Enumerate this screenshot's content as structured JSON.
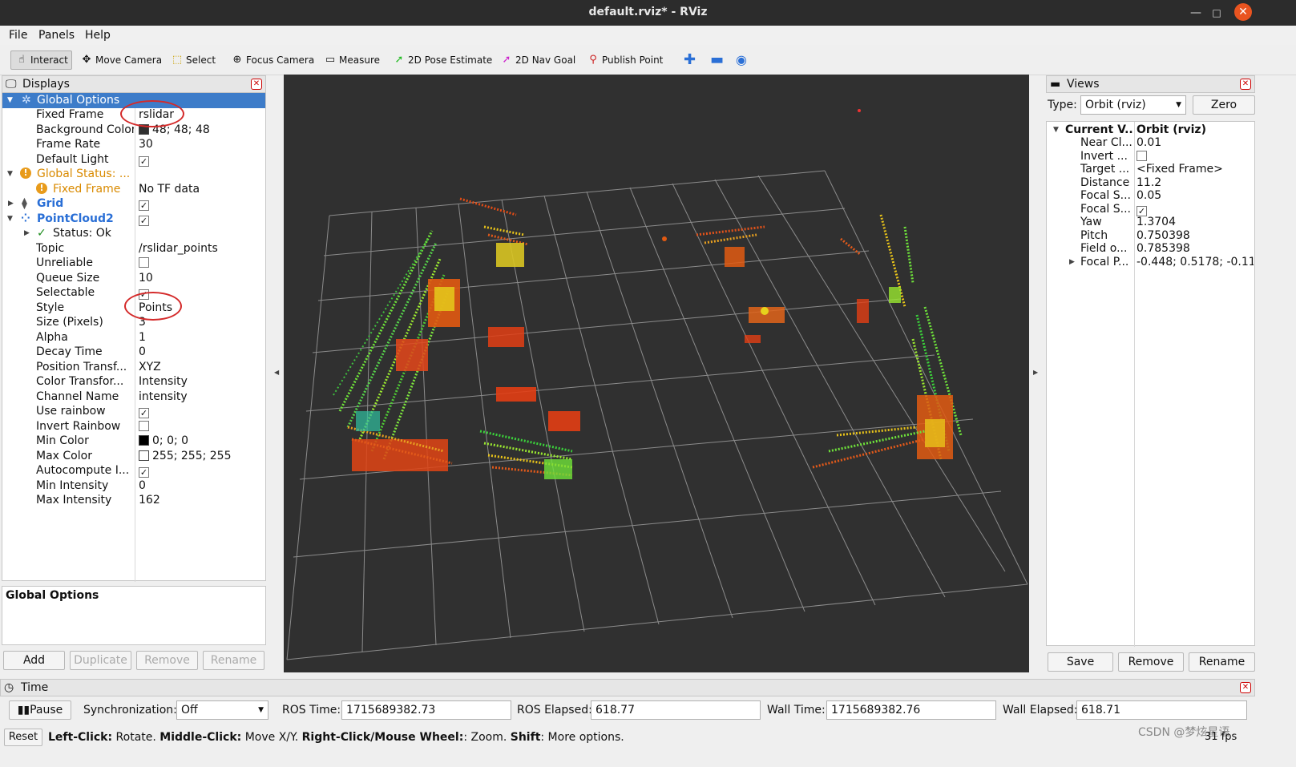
{
  "window": {
    "title": "default.rviz* - RViz"
  },
  "menu": [
    "File",
    "Panels",
    "Help"
  ],
  "toolbar": {
    "tools": [
      {
        "label": "Interact",
        "icon": "hand-icon",
        "color": "#333333"
      },
      {
        "label": "Move Camera",
        "icon": "move-camera-icon",
        "color": "#555555"
      },
      {
        "label": "Select",
        "icon": "select-icon",
        "color": "#c9a000"
      },
      {
        "label": "Focus Camera",
        "icon": "focus-camera-icon",
        "color": "#555555"
      },
      {
        "label": "Measure",
        "icon": "ruler-icon",
        "color": "#555555"
      },
      {
        "label": "2D Pose Estimate",
        "icon": "pose-arrow-icon",
        "color": "#22bb22"
      },
      {
        "label": "2D Nav Goal",
        "icon": "nav-goal-arrow-icon",
        "color": "#cc22cc"
      },
      {
        "label": "Publish Point",
        "icon": "map-pin-icon",
        "color": "#cc2222"
      }
    ]
  },
  "displays": {
    "title": "Displays",
    "rows": [
      {
        "key": "Global Options",
        "value": ""
      },
      {
        "key": "Fixed Frame",
        "value": "rslidar"
      },
      {
        "key": "Background Color",
        "value": "48; 48; 48"
      },
      {
        "key": "Frame Rate",
        "value": "30"
      },
      {
        "key": "Default Light",
        "value": ""
      },
      {
        "key": "Global Status: ...",
        "value": ""
      },
      {
        "key": "Fixed Frame",
        "value": "No TF data"
      },
      {
        "key": "Grid",
        "value": ""
      },
      {
        "key": "PointCloud2",
        "value": ""
      },
      {
        "key": "Status: Ok",
        "value": ""
      },
      {
        "key": "Topic",
        "value": "/rslidar_points"
      },
      {
        "key": "Unreliable",
        "value": ""
      },
      {
        "key": "Queue Size",
        "value": "10"
      },
      {
        "key": "Selectable",
        "value": ""
      },
      {
        "key": "Style",
        "value": "Points"
      },
      {
        "key": "Size (Pixels)",
        "value": "3"
      },
      {
        "key": "Alpha",
        "value": "1"
      },
      {
        "key": "Decay Time",
        "value": "0"
      },
      {
        "key": "Position Transf...",
        "value": "XYZ"
      },
      {
        "key": "Color Transfor...",
        "value": "Intensity"
      },
      {
        "key": "Channel Name",
        "value": "intensity"
      },
      {
        "key": "Use rainbow",
        "value": ""
      },
      {
        "key": "Invert Rainbow",
        "value": ""
      },
      {
        "key": "Min Color",
        "value": "0; 0; 0"
      },
      {
        "key": "Max Color",
        "value": "255; 255; 255"
      },
      {
        "key": "Autocompute I...",
        "value": ""
      },
      {
        "key": "Min Intensity",
        "value": "0"
      },
      {
        "key": "Max Intensity",
        "value": "162"
      }
    ],
    "description_title": "Global Options",
    "buttons": {
      "add": "Add",
      "duplicate": "Duplicate",
      "remove": "Remove",
      "rename": "Rename"
    }
  },
  "views": {
    "title": "Views",
    "type_label": "Type:",
    "type_value": "Orbit (rviz)",
    "zero": "Zero",
    "rows": [
      {
        "key": "Current V...",
        "value": "Orbit (rviz)"
      },
      {
        "key": "Near Cl...",
        "value": "0.01"
      },
      {
        "key": "Invert ...",
        "value": ""
      },
      {
        "key": "Target ...",
        "value": "<Fixed Frame>"
      },
      {
        "key": "Distance",
        "value": "11.2"
      },
      {
        "key": "Focal S...",
        "value": "0.05"
      },
      {
        "key": "Focal S...",
        "value": ""
      },
      {
        "key": "Yaw",
        "value": "1.3704"
      },
      {
        "key": "Pitch",
        "value": "0.750398"
      },
      {
        "key": "Field o...",
        "value": "0.785398"
      },
      {
        "key": "Focal P...",
        "value": "-0.448; 0.5178; -0.11..."
      }
    ],
    "buttons": {
      "save": "Save",
      "remove": "Remove",
      "rename": "Rename"
    }
  },
  "time": {
    "title": "Time",
    "pause": "Pause",
    "sync_label": "Synchronization:",
    "sync_value": "Off",
    "ros_time_label": "ROS Time:",
    "ros_time": "1715689382.73",
    "ros_elapsed_label": "ROS Elapsed:",
    "ros_elapsed": "618.77",
    "wall_time_label": "Wall Time:",
    "wall_time": "1715689382.76",
    "wall_elapsed_label": "Wall Elapsed:",
    "wall_elapsed": "618.71"
  },
  "statusbar": {
    "reset": "Reset",
    "h1": "Left-Click:",
    "t1": " Rotate. ",
    "h2": "Middle-Click:",
    "t2": " Move X/Y. ",
    "h3": "Right-Click/Mouse Wheel:",
    "t3": ": Zoom. ",
    "h4": "Shift",
    "t4": ": More options.",
    "fps": "31 fps",
    "watermark": "CSDN @梦炫星语"
  },
  "viewport": {
    "background": "#303030",
    "grid_color": "#a0a0a0"
  }
}
